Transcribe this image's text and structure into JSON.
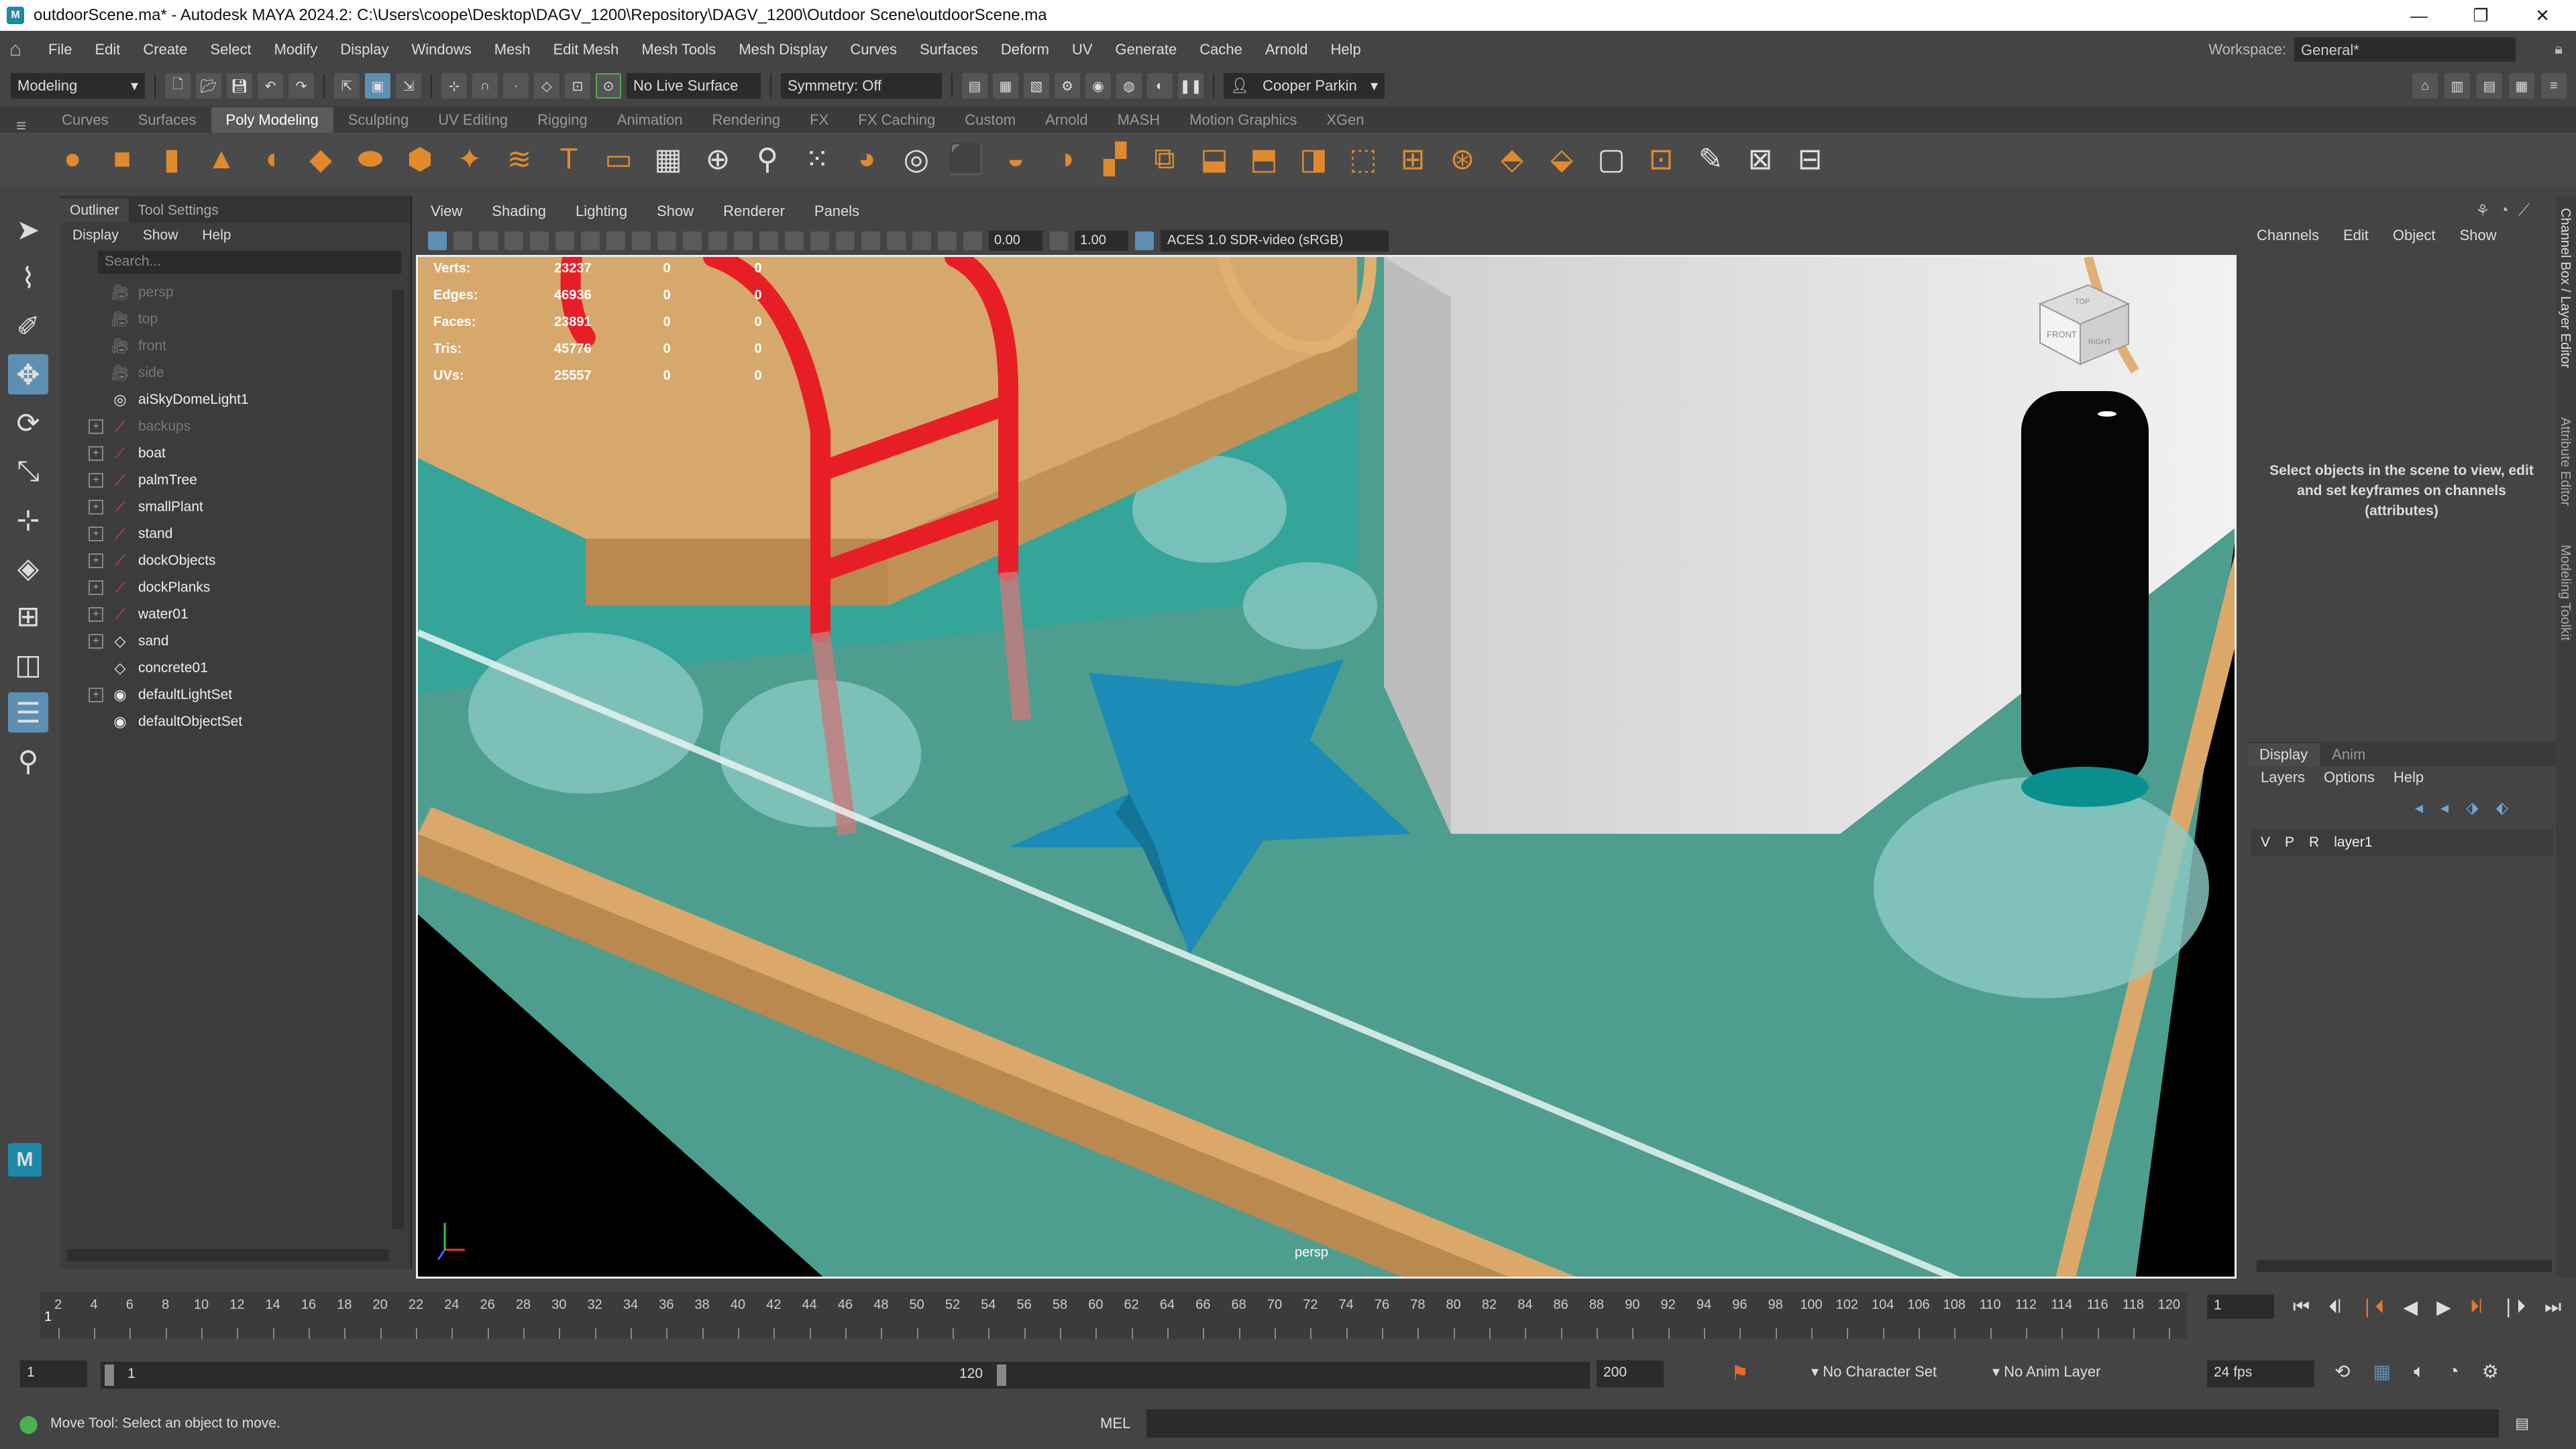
{
  "window": {
    "title": "outdoorScene.ma* - Autodesk MAYA 2024.2: C:\\Users\\coope\\Desktop\\DAGV_1200\\Repository\\DAGV_1200\\Outdoor Scene\\outdoorScene.ma",
    "minimize": "—",
    "maximize": "❐",
    "close": "✕"
  },
  "menubar": {
    "items": [
      "File",
      "Edit",
      "Create",
      "Select",
      "Modify",
      "Display",
      "Windows",
      "Mesh",
      "Edit Mesh",
      "Mesh Tools",
      "Mesh Display",
      "Curves",
      "Surfaces",
      "Deform",
      "UV",
      "Generate",
      "Cache",
      "Arnold",
      "Help"
    ],
    "workspace_label": "Workspace:",
    "workspace_value": "General*"
  },
  "statusline": {
    "mode": "Modeling",
    "live_surface": "No Live Surface",
    "symmetry": "Symmetry: Off",
    "user": "Cooper Parkin"
  },
  "shelf": {
    "tabs": [
      "Curves",
      "Surfaces",
      "Poly Modeling",
      "Sculpting",
      "UV Editing",
      "Rigging",
      "Animation",
      "Rendering",
      "FX",
      "FX Caching",
      "Custom",
      "Arnold",
      "MASH",
      "Motion Graphics",
      "XGen"
    ],
    "active_tab": "Poly Modeling"
  },
  "outliner": {
    "tabs": [
      "Outliner",
      "Tool Settings"
    ],
    "menus": [
      "Display",
      "Show",
      "Help"
    ],
    "search_placeholder": "Search...",
    "items": [
      {
        "name": "persp",
        "type": "camera",
        "expandable": false,
        "dim": true
      },
      {
        "name": "top",
        "type": "camera",
        "expandable": false,
        "dim": true
      },
      {
        "name": "front",
        "type": "camera",
        "expandable": false,
        "dim": true
      },
      {
        "name": "side",
        "type": "camera",
        "expandable": false,
        "dim": true
      },
      {
        "name": "aiSkyDomeLight1",
        "type": "light",
        "expandable": false,
        "dim": false
      },
      {
        "name": "backups",
        "type": "transform",
        "expandable": true,
        "dim": true
      },
      {
        "name": "boat",
        "type": "transform",
        "expandable": true,
        "dim": false
      },
      {
        "name": "palmTree",
        "type": "transform",
        "expandable": true,
        "dim": false
      },
      {
        "name": "smallPlant",
        "type": "transform",
        "expandable": true,
        "dim": false
      },
      {
        "name": "stand",
        "type": "transform",
        "expandable": true,
        "dim": false
      },
      {
        "name": "dockObjects",
        "type": "transform",
        "expandable": true,
        "dim": false
      },
      {
        "name": "dockPlanks",
        "type": "transform",
        "expandable": true,
        "dim": false
      },
      {
        "name": "water01",
        "type": "transform",
        "expandable": true,
        "dim": false
      },
      {
        "name": "sand",
        "type": "mesh",
        "expandable": true,
        "dim": false
      },
      {
        "name": "concrete01",
        "type": "mesh",
        "expandable": false,
        "dim": false
      },
      {
        "name": "defaultLightSet",
        "type": "set",
        "expandable": true,
        "dim": false
      },
      {
        "name": "defaultObjectSet",
        "type": "set",
        "expandable": false,
        "dim": false
      }
    ]
  },
  "viewport": {
    "menus": [
      "View",
      "Shading",
      "Lighting",
      "Show",
      "Renderer",
      "Panels"
    ],
    "exposure": "0.00",
    "gamma": "1.00",
    "color_space": "ACES 1.0 SDR-video (sRGB)",
    "camera": "persp",
    "hud": [
      {
        "label": "Verts:",
        "value": "23237",
        "sel": "0",
        "comp": "0"
      },
      {
        "label": "Edges:",
        "value": "46936",
        "sel": "0",
        "comp": "0"
      },
      {
        "label": "Faces:",
        "value": "23891",
        "sel": "0",
        "comp": "0"
      },
      {
        "label": "Tris:",
        "value": "45776",
        "sel": "0",
        "comp": "0"
      },
      {
        "label": "UVs:",
        "value": "25557",
        "sel": "0",
        "comp": "0"
      }
    ],
    "viewcube_front": "FRONT",
    "viewcube_right": "RIGHT",
    "viewcube_top": "TOP"
  },
  "channelbox": {
    "menus": [
      "Channels",
      "Edit",
      "Object",
      "Show"
    ],
    "message": "Select objects in the scene to view, edit and set keyframes on channels (attributes)"
  },
  "layers": {
    "tabs": [
      "Display",
      "Anim"
    ],
    "menus": [
      "Layers",
      "Options",
      "Help"
    ],
    "row": {
      "v": "V",
      "p": "P",
      "r": "R",
      "name": "layer1"
    }
  },
  "sidetabs": [
    "Channel Box / Layer Editor",
    "Attribute Editor",
    "Modeling Toolkit"
  ],
  "timeline": {
    "ticks": [
      2,
      4,
      6,
      8,
      10,
      12,
      14,
      16,
      18,
      20,
      22,
      24,
      26,
      28,
      30,
      32,
      34,
      36,
      38,
      40,
      42,
      44,
      46,
      48,
      50,
      52,
      54,
      56,
      58,
      60,
      62,
      64,
      66,
      68,
      70,
      72,
      74,
      76,
      78,
      80,
      82,
      84,
      86,
      88,
      90,
      92,
      94,
      96,
      98,
      100,
      102,
      104,
      106,
      108,
      110,
      112,
      114,
      116,
      118,
      120
    ],
    "current_frame": "1",
    "cursor": "1"
  },
  "range": {
    "start": "1",
    "inner_start": "1",
    "inner_end": "120",
    "end": "200",
    "character_set": "No Character Set",
    "anim_layer": "No Anim Layer",
    "fps": "24 fps"
  },
  "helpline": {
    "text": "Move Tool: Select an object to move.",
    "mel": "MEL"
  }
}
